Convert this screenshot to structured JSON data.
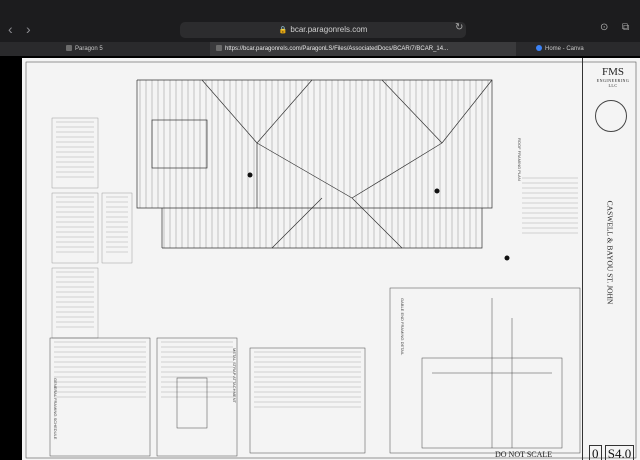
{
  "browser": {
    "url": "bcar.paragonrels.com",
    "tabs": [
      {
        "label": "Paragon 5",
        "active": false
      },
      {
        "label": "https://bcar.paragonrels.com/ParagonLS/Files/AssociatedDocs/BCAR/7/BCAR_14...",
        "active": true
      },
      {
        "label": "Home - Canva",
        "active": false
      }
    ]
  },
  "drawing": {
    "firm_logo": "FMS",
    "firm_sub": "ENGINEERING LLC",
    "project_title": "CASWELL & BAYOU ST. JOHN",
    "plan_title": "ROOF FRAMING PLAN",
    "truss_detail": "GABLE END FRAMING DETAIL",
    "metal_strap": "METAL STRAP ATTACHMENT",
    "schedule_title": "GENERAL FRAMING SCHEDULE",
    "nts_label": "DO NOT SCALE",
    "sheet_prefix": "0",
    "sheet_number": "S4.0"
  }
}
